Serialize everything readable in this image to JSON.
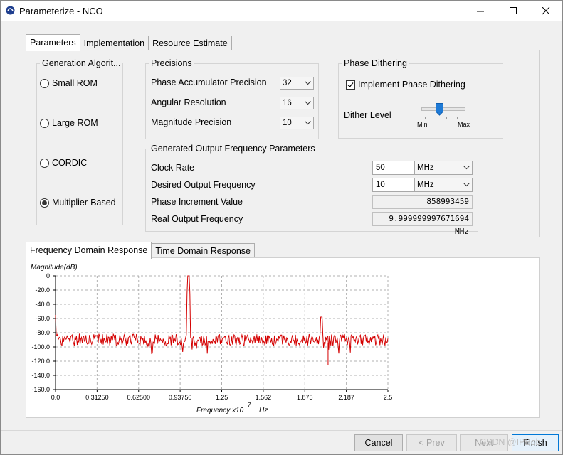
{
  "window": {
    "title": "Parameterize - NCO"
  },
  "tabs_top": [
    "Parameters",
    "Implementation",
    "Resource Estimate"
  ],
  "generation": {
    "label": "Generation Algorit...",
    "options": [
      "Small ROM",
      "Large ROM",
      "CORDIC",
      "Multiplier-Based"
    ],
    "selected": "Multiplier-Based"
  },
  "precisions": {
    "label": "Precisions",
    "phase_acc": {
      "label": "Phase Accumulator Precision",
      "value": "32"
    },
    "angular": {
      "label": "Angular Resolution",
      "value": "16"
    },
    "magnitude": {
      "label": "Magnitude Precision",
      "value": "10"
    }
  },
  "dithering": {
    "label": "Phase Dithering",
    "implement_label": "Implement Phase Dithering",
    "implement_checked": true,
    "level_label": "Dither Level",
    "min_label": "Min",
    "max_label": "Max",
    "level": 0.4
  },
  "output": {
    "label": "Generated Output Frequency Parameters",
    "clock": {
      "label": "Clock Rate",
      "value": "50",
      "unit": "MHz"
    },
    "desired": {
      "label": "Desired Output Frequency",
      "value": "10",
      "unit": "MHz"
    },
    "phase_inc": {
      "label": "Phase Increment Value",
      "value": "858993459"
    },
    "real": {
      "label": "Real Output Frequency",
      "value": "9.999999997671694 MHz"
    }
  },
  "tabs_bottom": [
    "Frequency Domain Response",
    "Time Domain Response"
  ],
  "chart_data": {
    "type": "line",
    "ylabel": "Magnitude(dB)",
    "xlabel": "Frequency x10",
    "xlabel_exp": "7",
    "xlabel_unit": "Hz",
    "ylim": [
      -160,
      0
    ],
    "xlim": [
      0,
      2.5
    ],
    "grid": true,
    "y_ticks": [
      "0",
      "-20.0",
      "-40.0",
      "-60.0",
      "-80.0",
      "-100.0",
      "-120.0",
      "-140.0",
      "-160.0"
    ],
    "x_ticks": [
      "0.0",
      "0.31250",
      "0.62500",
      "0.93750",
      "1.25",
      "1.562",
      "1.875",
      "2.187",
      "2.5"
    ],
    "noise_floor_db": -90,
    "peaks": [
      {
        "x": 1.0,
        "y": 0
      },
      {
        "x": 2.0,
        "y": -58
      }
    ],
    "color": "#d40000"
  },
  "buttons": {
    "cancel": "Cancel",
    "prev": "< Prev",
    "next": "Next",
    "finish": "Finish"
  },
  "watermark": "CSDN @IPBob"
}
